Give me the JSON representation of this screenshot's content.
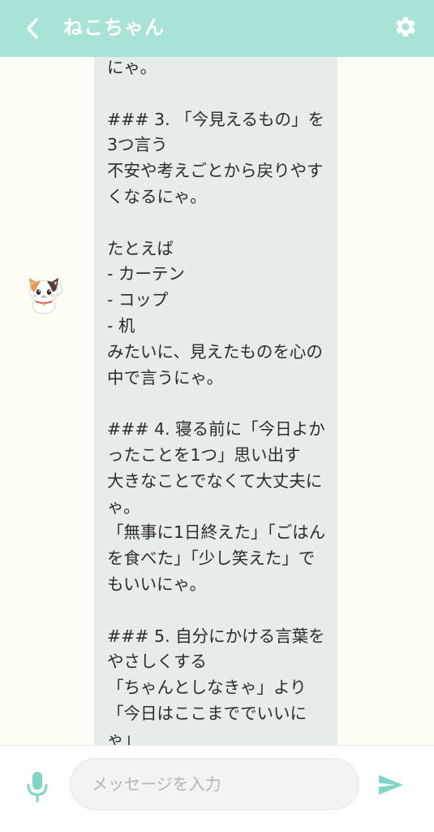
{
  "header": {
    "title": "ねこちゃん",
    "back_icon": "chevron-left-icon",
    "settings_icon": "gear-icon",
    "background_color": "#a8e3d8"
  },
  "chat": {
    "avatar": "calico-cat-avatar",
    "message_text": "にゃ。\n\n### 3. 「今見えるもの」を3つ言う\n不安や考えごとから戻りやすくなるにゃ。\n\nたとえば\n- カーテン\n- コップ\n- 机\nみたいに、見えたものを心の中で言うにゃ。\n\n### 4. 寝る前に「今日よかったことを1つ」思い出す\n大きなことでなくて大丈夫にゃ。\n「無事に1日終えた」「ごはんを食べた」「少し笑えた」でもいいにゃ。\n\n### 5. 自分にかける言葉をやさしくする\n「ちゃんとしなきゃ」より\n「今日はここまででいいにゃ」",
    "bubble_color": "#e6ecec"
  },
  "footer": {
    "mic_icon": "microphone-icon",
    "input_placeholder": "メッセージを入力",
    "input_value": "",
    "send_icon": "send-icon",
    "accent_color": "#7fd6c4"
  }
}
